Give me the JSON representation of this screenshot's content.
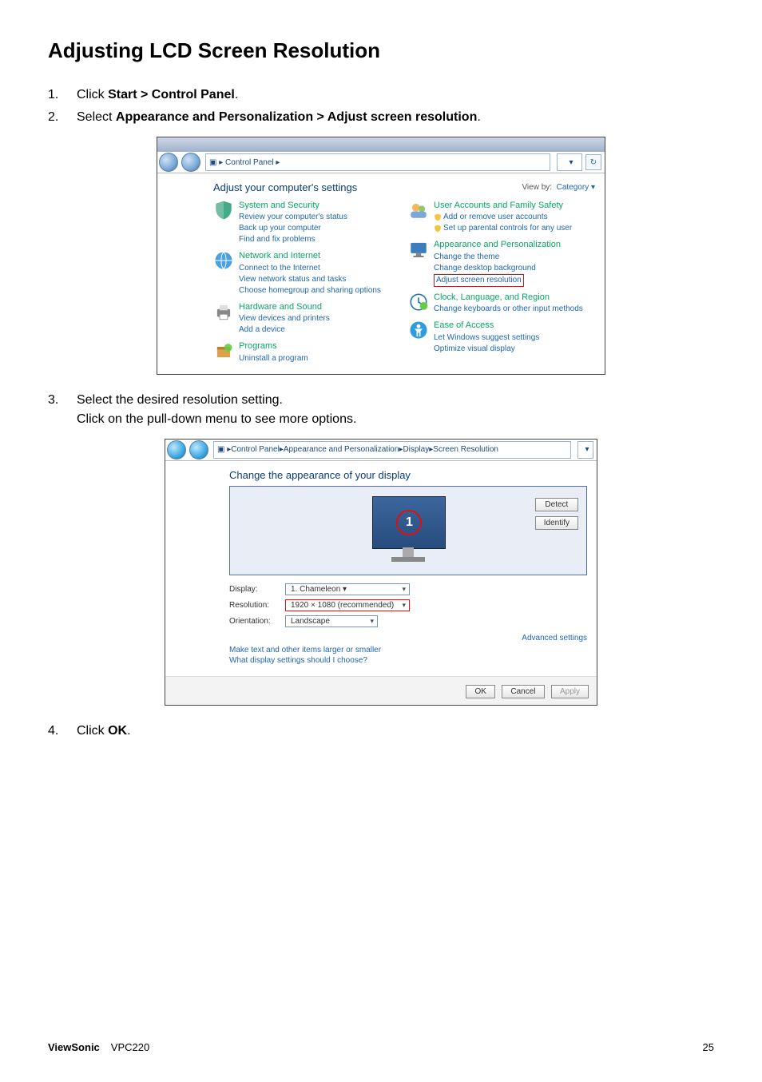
{
  "doc": {
    "title": "Adjusting LCD Screen Resolution",
    "steps": {
      "1": "Click <b>Start > Control Panel</b>.",
      "2": "Select <b>Appearance and Personalization > Adjust screen resolution</b>.",
      "3": "Select the desired resolution setting.<br>Click on the pull-down menu to see more options.",
      "4": "Click <b>OK</b>."
    },
    "footer": {
      "brand": "ViewSonic",
      "model": "VPC220",
      "page": "25"
    }
  },
  "cp": {
    "breadcrumb_sep": "▸",
    "breadcrumb1": "Control Panel",
    "breadcrumb_trail": "▸",
    "title": "Adjust your computer's settings",
    "viewby_label": "View by:",
    "viewby_value": "Category ▾",
    "left": [
      {
        "head": "System and Security",
        "subs": [
          "Review your computer's status",
          "Back up your computer",
          "Find and fix problems"
        ],
        "icon": "shield"
      },
      {
        "head": "Network and Internet",
        "subs": [
          "Connect to the Internet",
          "View network status and tasks",
          "Choose homegroup and sharing options"
        ],
        "icon": "globe"
      },
      {
        "head": "Hardware and Sound",
        "subs": [
          "View devices and printers",
          "Add a device"
        ],
        "icon": "printer"
      },
      {
        "head": "Programs",
        "subs": [
          "Uninstall a program"
        ],
        "icon": "box"
      }
    ],
    "right": [
      {
        "head": "User Accounts and Family Safety",
        "subs": [
          {
            "t": "Add or remove user accounts",
            "shield": true
          },
          {
            "t": "Set up parental controls for any user",
            "shield": true
          }
        ],
        "icon": "users"
      },
      {
        "head": "Appearance and Personalization",
        "subs": [
          "Change the theme",
          "Change desktop background",
          {
            "t": "Adjust screen resolution",
            "red": true
          }
        ],
        "icon": "desktop"
      },
      {
        "head": "Clock, Language, and Region",
        "subs": [
          "Change keyboards or other input methods"
        ],
        "icon": "clock"
      },
      {
        "head": "Ease of Access",
        "subs": [
          "Let Windows suggest settings",
          "Optimize visual display"
        ],
        "icon": "ease"
      }
    ]
  },
  "sr": {
    "crumb": [
      "Control Panel",
      "Appearance and Personalization",
      "Display",
      "Screen Resolution"
    ],
    "title": "Change the appearance of your display",
    "detect": "Detect",
    "identify": "Identify",
    "monitor_num": "1",
    "display_label": "Display:",
    "display_value": "1. Chameleon ▾",
    "resolution_label": "Resolution:",
    "resolution_value": "1920 × 1080 (recommended)",
    "orientation_label": "Orientation:",
    "orientation_value": "Landscape",
    "advanced": "Advanced settings",
    "link1": "Make text and other items larger or smaller",
    "link2": "What display settings should I choose?",
    "ok": "OK",
    "cancel": "Cancel",
    "apply": "Apply"
  }
}
